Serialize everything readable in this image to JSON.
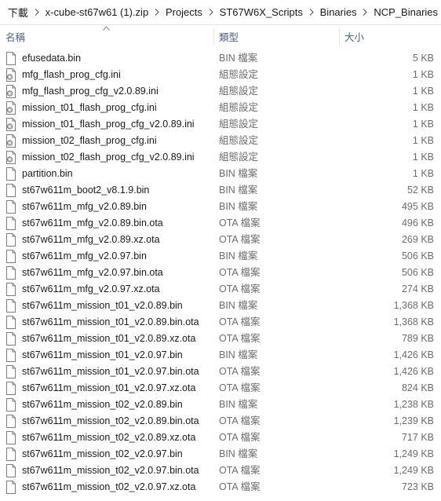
{
  "breadcrumb": [
    "下載",
    "x-cube-st67w61 (1).zip",
    "Projects",
    "ST67W6X_Scripts",
    "Binaries",
    "NCP_Binaries"
  ],
  "columns": {
    "name": "名稱",
    "type": "類型",
    "size": "大小"
  },
  "files": [
    {
      "name": "efusedata.bin",
      "type": "BIN 檔案",
      "size": "5 KB",
      "icon": "file-icon"
    },
    {
      "name": "mfg_flash_prog_cfg.ini",
      "type": "組態設定",
      "size": "1 KB",
      "icon": "config-file-icon"
    },
    {
      "name": "mfg_flash_prog_cfg_v2.0.89.ini",
      "type": "組態設定",
      "size": "1 KB",
      "icon": "config-file-icon"
    },
    {
      "name": "mission_t01_flash_prog_cfg.ini",
      "type": "組態設定",
      "size": "1 KB",
      "icon": "config-file-icon"
    },
    {
      "name": "mission_t01_flash_prog_cfg_v2.0.89.ini",
      "type": "組態設定",
      "size": "1 KB",
      "icon": "config-file-icon"
    },
    {
      "name": "mission_t02_flash_prog_cfg.ini",
      "type": "組態設定",
      "size": "1 KB",
      "icon": "config-file-icon"
    },
    {
      "name": "mission_t02_flash_prog_cfg_v2.0.89.ini",
      "type": "組態設定",
      "size": "1 KB",
      "icon": "config-file-icon"
    },
    {
      "name": "partition.bin",
      "type": "BIN 檔案",
      "size": "1 KB",
      "icon": "file-icon"
    },
    {
      "name": "st67w611m_boot2_v8.1.9.bin",
      "type": "BIN 檔案",
      "size": "52 KB",
      "icon": "file-icon"
    },
    {
      "name": "st67w611m_mfg_v2.0.89.bin",
      "type": "BIN 檔案",
      "size": "495 KB",
      "icon": "file-icon"
    },
    {
      "name": "st67w611m_mfg_v2.0.89.bin.ota",
      "type": "OTA 檔案",
      "size": "496 KB",
      "icon": "file-icon"
    },
    {
      "name": "st67w611m_mfg_v2.0.89.xz.ota",
      "type": "OTA 檔案",
      "size": "269 KB",
      "icon": "file-icon"
    },
    {
      "name": "st67w611m_mfg_v2.0.97.bin",
      "type": "BIN 檔案",
      "size": "506 KB",
      "icon": "file-icon"
    },
    {
      "name": "st67w611m_mfg_v2.0.97.bin.ota",
      "type": "OTA 檔案",
      "size": "506 KB",
      "icon": "file-icon"
    },
    {
      "name": "st67w611m_mfg_v2.0.97.xz.ota",
      "type": "OTA 檔案",
      "size": "274 KB",
      "icon": "file-icon"
    },
    {
      "name": "st67w611m_mission_t01_v2.0.89.bin",
      "type": "BIN 檔案",
      "size": "1,368 KB",
      "icon": "file-icon"
    },
    {
      "name": "st67w611m_mission_t01_v2.0.89.bin.ota",
      "type": "OTA 檔案",
      "size": "1,368 KB",
      "icon": "file-icon"
    },
    {
      "name": "st67w611m_mission_t01_v2.0.89.xz.ota",
      "type": "OTA 檔案",
      "size": "789 KB",
      "icon": "file-icon"
    },
    {
      "name": "st67w611m_mission_t01_v2.0.97.bin",
      "type": "BIN 檔案",
      "size": "1,426 KB",
      "icon": "file-icon"
    },
    {
      "name": "st67w611m_mission_t01_v2.0.97.bin.ota",
      "type": "OTA 檔案",
      "size": "1,426 KB",
      "icon": "file-icon"
    },
    {
      "name": "st67w611m_mission_t01_v2.0.97.xz.ota",
      "type": "OTA 檔案",
      "size": "824 KB",
      "icon": "file-icon"
    },
    {
      "name": "st67w611m_mission_t02_v2.0.89.bin",
      "type": "BIN 檔案",
      "size": "1,238 KB",
      "icon": "file-icon"
    },
    {
      "name": "st67w611m_mission_t02_v2.0.89.bin.ota",
      "type": "OTA 檔案",
      "size": "1,239 KB",
      "icon": "file-icon"
    },
    {
      "name": "st67w611m_mission_t02_v2.0.89.xz.ota",
      "type": "OTA 檔案",
      "size": "717 KB",
      "icon": "file-icon"
    },
    {
      "name": "st67w611m_mission_t02_v2.0.97.bin",
      "type": "BIN 檔案",
      "size": "1,249 KB",
      "icon": "file-icon"
    },
    {
      "name": "st67w611m_mission_t02_v2.0.97.bin.ota",
      "type": "OTA 檔案",
      "size": "1,249 KB",
      "icon": "file-icon"
    },
    {
      "name": "st67w611m_mission_t02_v2.0.97.xz.ota",
      "type": "OTA 檔案",
      "size": "723 KB",
      "icon": "file-icon"
    }
  ]
}
